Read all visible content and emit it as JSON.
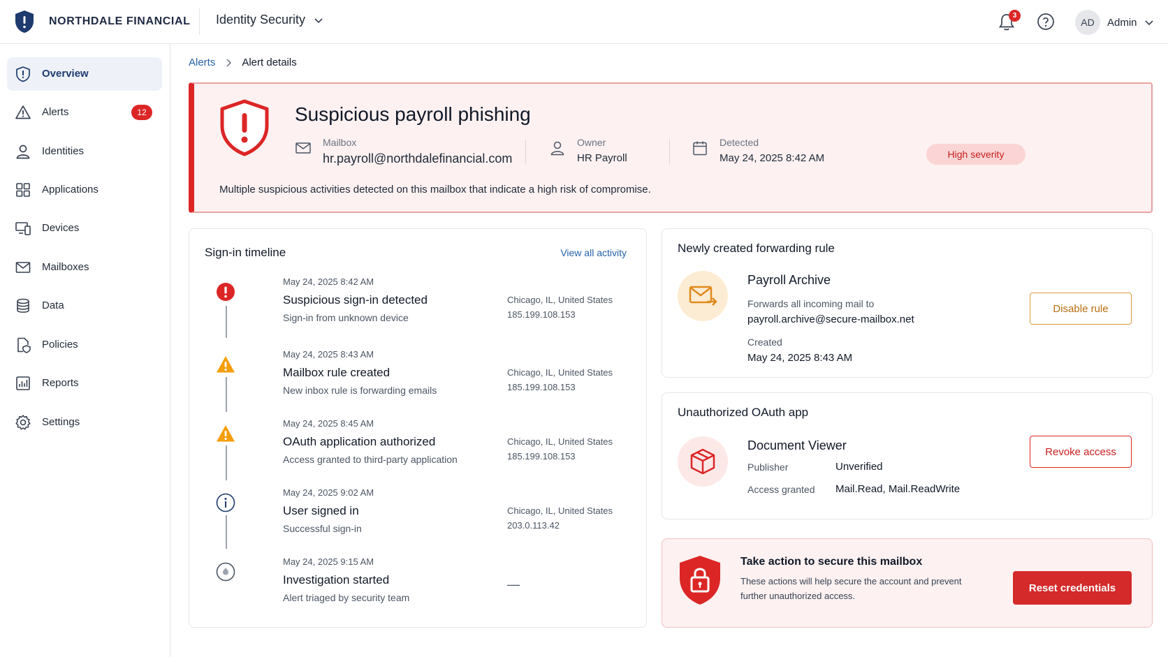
{
  "header": {
    "brand_name": "NORTHDALE FINANCIAL",
    "product_name": "Identity Security",
    "notifications_count": "3",
    "user_initials": "AD",
    "user_name": "Admin",
    "icons": [
      "shield-logo-icon",
      "chevron-down-icon",
      "bell-icon",
      "help-icon"
    ]
  },
  "sidebar": {
    "items": [
      {
        "label": "Overview",
        "icon": "shield-icon",
        "active": true
      },
      {
        "label": "Alerts",
        "icon": "warning-icon",
        "badge": "12"
      },
      {
        "label": "Identities",
        "icon": "user-icon"
      },
      {
        "label": "Applications",
        "icon": "grid-icon"
      },
      {
        "label": "Devices",
        "icon": "devices-icon"
      },
      {
        "label": "Mailboxes",
        "icon": "mail-icon"
      },
      {
        "label": "Data",
        "icon": "database-icon"
      },
      {
        "label": "Policies",
        "icon": "policy-icon"
      },
      {
        "label": "Reports",
        "icon": "chart-icon"
      },
      {
        "label": "Settings",
        "icon": "gear-icon"
      }
    ]
  },
  "breadcrumb": {
    "parent": "Alerts",
    "current": "Alert details"
  },
  "alert": {
    "title": "Suspicious payroll phishing",
    "mailbox_label": "Mailbox",
    "mailbox_value": "hr.payroll@northdalefinancial.com",
    "owner_label": "Owner",
    "owner_value": "HR Payroll",
    "detected_label": "Detected",
    "detected_value": "May 24, 2025 8:42 AM",
    "severity": "High severity",
    "description": "Multiple suspicious activities detected on this mailbox that indicate a high risk of compromise."
  },
  "timeline": {
    "title": "Sign-in timeline",
    "view_all": "View all activity",
    "events": [
      {
        "time": "May 24, 2025 8:42 AM",
        "title": "Suspicious sign-in detected",
        "subtitle": "Sign-in from unknown device",
        "location": "Chicago, IL, United States",
        "ip": "185.199.108.153",
        "icon": "error-icon"
      },
      {
        "time": "May 24, 2025 8:43 AM",
        "title": "Mailbox rule created",
        "subtitle": "New inbox rule is forwarding emails",
        "location": "Chicago, IL, United States",
        "ip": "185.199.108.153",
        "icon": "warning-icon"
      },
      {
        "time": "May 24, 2025 8:45 AM",
        "title": "OAuth application authorized",
        "subtitle": "Access granted to third-party application",
        "location": "Chicago, IL, United States",
        "ip": "185.199.108.153",
        "icon": "warning-icon"
      },
      {
        "time": "May 24, 2025 9:02 AM",
        "title": "User signed in",
        "subtitle": "Successful sign-in",
        "location": "Chicago, IL,  United States",
        "ip": "203.0.113.42",
        "icon": "info-icon"
      },
      {
        "time": "May 24, 2025 9:15 AM",
        "title": "Investigation started",
        "subtitle": "Alert triaged by security team",
        "location": "—",
        "ip": "",
        "icon": "investigation-icon"
      }
    ]
  },
  "forwarding_rule": {
    "section_title": "Newly created forwarding rule",
    "name": "Payroll Archive",
    "description": "Forwards all incoming mail to",
    "target": "payroll.archive@secure-mailbox.net",
    "created_label": "Created",
    "created_value": "May 24, 2025 8:43 AM",
    "action_label": "Disable rule",
    "icon": "mail-forward-icon"
  },
  "oauth_app": {
    "section_title": "Unauthorized OAuth app",
    "name": "Document Viewer",
    "publisher_label": "Publisher",
    "publisher_value": "Unverified",
    "access_label": "Access granted",
    "access_value": "Mail.Read, Mail.ReadWrite",
    "action_label": "Revoke access",
    "icon": "package-icon"
  },
  "secure_action": {
    "title": "Take action to secure this mailbox",
    "description": "These actions will help secure the account and prevent further unauthorized access.",
    "action_label": "Reset credentials",
    "icon": "shield-lock-icon"
  },
  "colors": {
    "brand": "#1e3a6e",
    "danger": "#dc2626",
    "warning": "#f59e0b",
    "link": "#2563a8",
    "alert_bg": "#fdf1f1"
  }
}
